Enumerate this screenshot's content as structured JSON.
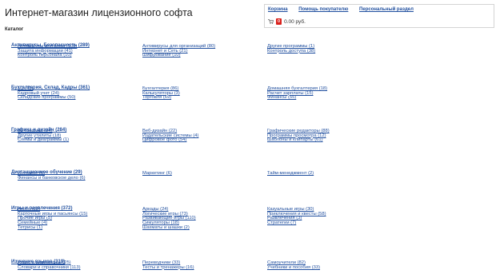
{
  "header": {
    "title": "Интернет-магазин лицензионного софта"
  },
  "cart": {
    "links": [
      "Корзина",
      "Помощь покупателю",
      "Персональный раздел"
    ],
    "count": "0",
    "total": "0.00 руб."
  },
  "catalog_label": "Каталог",
  "categories": [
    {
      "title": "Антивирусы, Безопасность (289)",
      "cols": [
        [
          "Антивирусы для дома (108)",
          "Защита информации (41)",
          "Контроль персонала (10)"
        ],
        [
          "Антивирусы для организаций (80)",
          "Интернет и Сеть (21)",
          "Шифрование (10)"
        ],
        [
          "Другие программы (1)",
          "Контроль доступа (38)"
        ]
      ]
    },
    {
      "title": "Бухгалтерия, Склад, Кадры (361)",
      "cols": [
        [
          "1С (41)",
          "Кадровый учет (24)",
          "Складские программы (50)"
        ],
        [
          "Бухгалтерия (86)",
          "Калькуляторы (3)",
          "Торговля (69)"
        ],
        [
          "Домашняя бухгалтерия (18)",
          "Расчет зарплаты (15)",
          "Финансы (55)"
        ]
      ]
    },
    {
      "title": "Графика и дизайн (284)",
      "cols": [
        [
          "3D графика (24)",
          "Другие утилиты (18)",
          "Схемы и диаграммы (1)"
        ],
        [
          "Веб-дизайн (22)",
          "Издательские системы (4)",
          "Цифровое фото (54)"
        ],
        [
          "Графические редакторы (88)",
          "Программы просмотра (12)",
          "Шаблоны и клипарты (61)"
        ]
      ]
    },
    {
      "title": "Дистанционное обучение (29)",
      "cols": [
        [
          "Интернет (6)",
          "Финансы и банковское дело (6)"
        ],
        [
          "Маркетинг (6)"
        ],
        [
          "Тайм-менеджмент (2)"
        ]
      ]
    },
    {
      "title": "Игры и развлечения (372)",
      "cols": [
        [
          "Action (22)",
          "Карточные игры и пасьянсы (15)",
          "Прочие игры (5)",
          "Семейные (4)",
          "Тетрисы (1)"
        ],
        [
          "Аркады (24)",
          "Логические игры (73)",
          "Развивающие игры (110)",
          "Симуляторы (18)",
          "Шахматы и шашки (2)"
        ],
        [
          "Казуальные игры (30)",
          "Приключения и квесты (58)",
          "Развлечения (3)",
          "Стратегии (7)"
        ]
      ]
    },
    {
      "title": "Изучение языков (319)",
      "cols": [
        [
          "Аудио и видеокурсы (25)",
          "Словари и справочники (113)"
        ],
        [
          "Переводчики (33)",
          "Тесты и тренажеры (16)"
        ],
        [
          "Самоучители (82)",
          "Учебники и пособия (33)"
        ]
      ]
    }
  ]
}
